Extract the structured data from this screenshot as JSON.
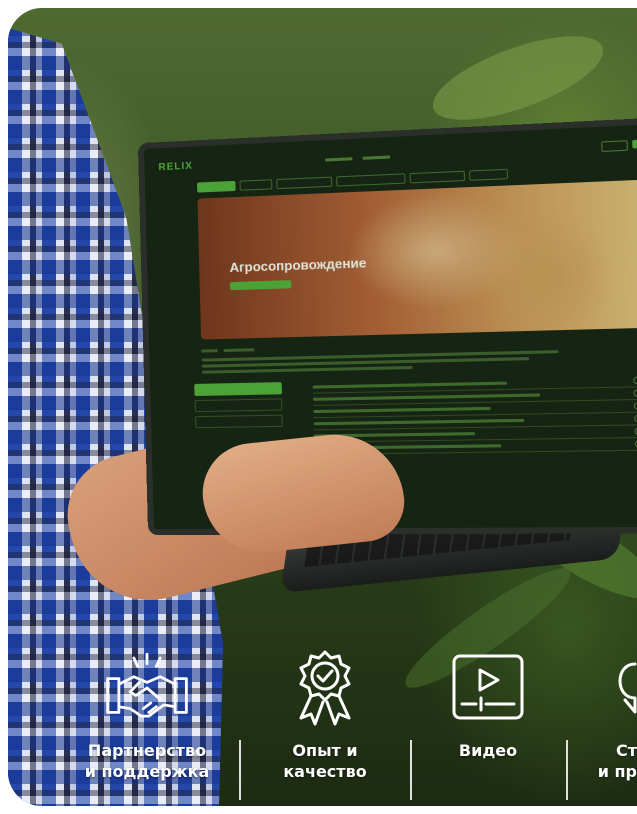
{
  "laptop_site": {
    "logo": "RELIX",
    "hero_title": "Агросопровождение"
  },
  "features": [
    {
      "icon": "handshake-icon",
      "label": "Партнерство\nи поддержка"
    },
    {
      "icon": "award-badge-icon",
      "label": "Опыт и\nкачество"
    },
    {
      "icon": "video-player-icon",
      "label": "Видео"
    },
    {
      "icon": "chat-bubble-icon",
      "label": "Ст\nи пр"
    }
  ],
  "colors": {
    "accent": "#4fae3a",
    "text": "#ffffff"
  }
}
